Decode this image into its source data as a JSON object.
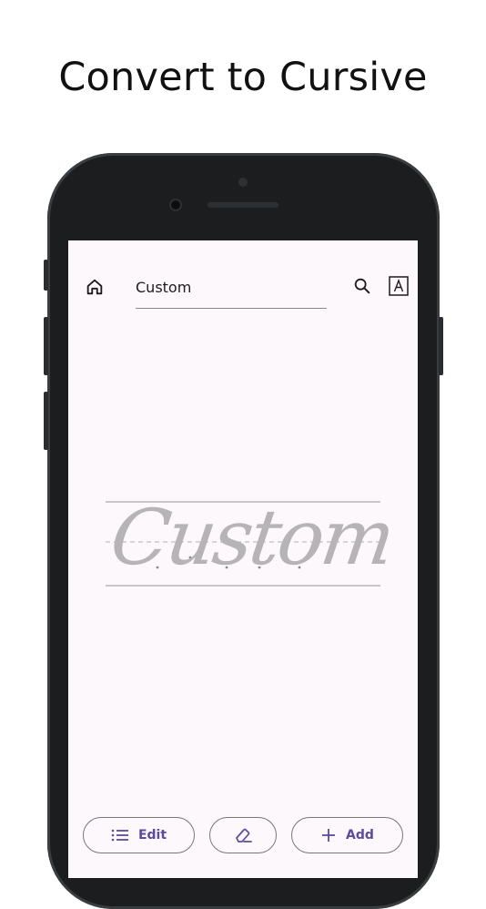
{
  "headline": "Convert to Cursive",
  "toolbar": {
    "title_value": "Custom",
    "home_icon": "home-icon",
    "search_icon": "search-icon",
    "font_icon": "font-box-icon"
  },
  "practice": {
    "word": "Custom"
  },
  "bottom_bar": {
    "edit_label": "Edit",
    "add_label": "Add",
    "eraser_icon": "eraser-icon"
  },
  "colors": {
    "screen_bg": "#fdf8fc",
    "accent": "#5b4a9e",
    "trace_gray": "#b4b2b4"
  }
}
